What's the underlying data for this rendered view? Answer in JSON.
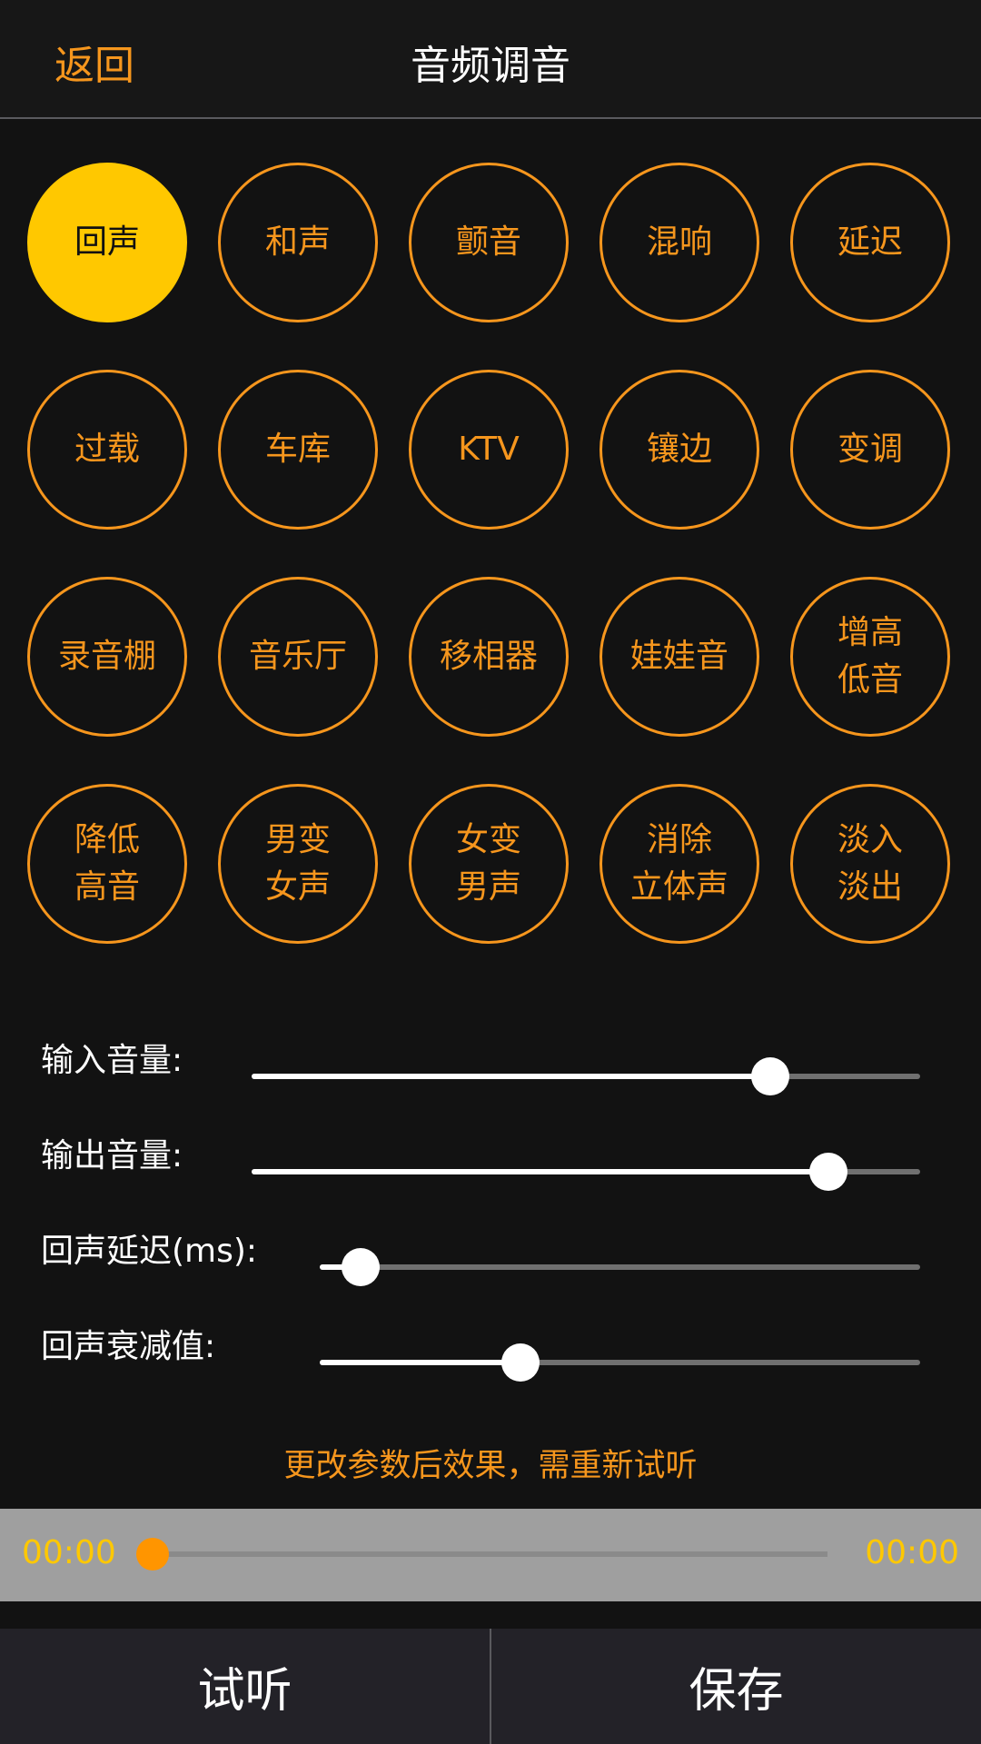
{
  "header": {
    "back_label": "返回",
    "title": "音频调音"
  },
  "effects": [
    {
      "label": "回声",
      "active": true
    },
    {
      "label": "和声",
      "active": false
    },
    {
      "label": "颤音",
      "active": false
    },
    {
      "label": "混响",
      "active": false
    },
    {
      "label": "延迟",
      "active": false
    },
    {
      "label": "过载",
      "active": false
    },
    {
      "label": "车库",
      "active": false
    },
    {
      "label": "KTV",
      "active": false
    },
    {
      "label": "镶边",
      "active": false
    },
    {
      "label": "变调",
      "active": false
    },
    {
      "label": "录音棚",
      "active": false
    },
    {
      "label": "音乐厅",
      "active": false
    },
    {
      "label": "移相器",
      "active": false
    },
    {
      "label": "娃娃音",
      "active": false
    },
    {
      "label": "增高\n低音",
      "active": false
    },
    {
      "label": "降低\n高音",
      "active": false
    },
    {
      "label": "男变\n女声",
      "active": false
    },
    {
      "label": "女变\n男声",
      "active": false
    },
    {
      "label": "消除\n立体声",
      "active": false
    },
    {
      "label": "淡入\n淡出",
      "active": false
    }
  ],
  "sliders": [
    {
      "label": "输入音量:",
      "value": 0.776
    },
    {
      "label": "输出音量:",
      "value": 0.863
    },
    {
      "label": "回声延迟(ms):",
      "value": 0.068
    },
    {
      "label": "回声衰减值:",
      "value": 0.334
    }
  ],
  "hint": "更改参数后效果，需重新试听",
  "player": {
    "current_time": "00:00",
    "total_time": "00:00",
    "progress": 0
  },
  "footer": {
    "preview_label": "试听",
    "save_label": "保存"
  },
  "colors": {
    "accent": "#f6961d",
    "active": "#ffc800",
    "player_thumb": "#ff9500"
  }
}
